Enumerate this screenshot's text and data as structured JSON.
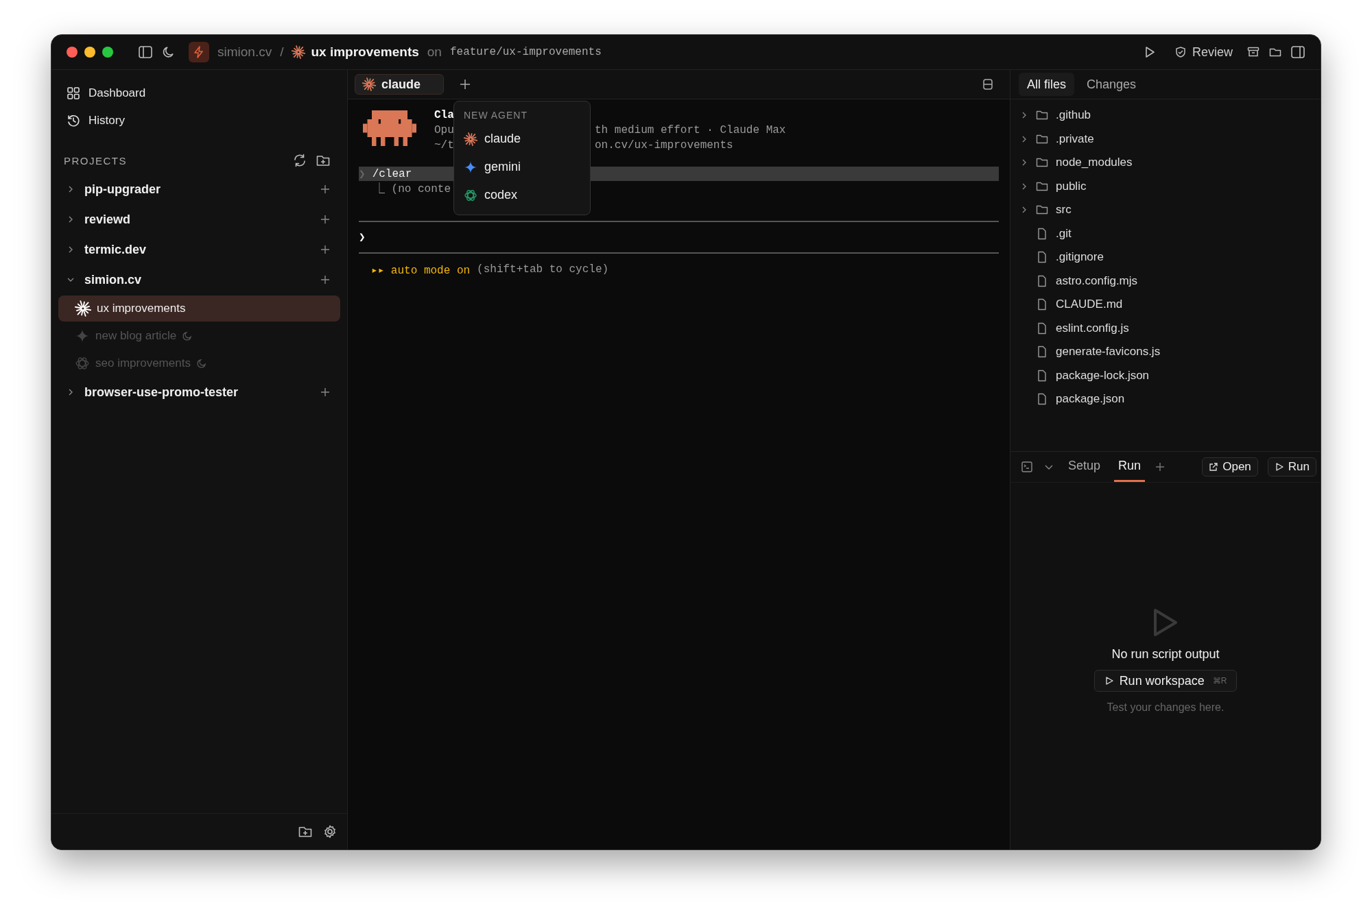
{
  "title_bar": {
    "project": "simion.cv",
    "separator": "/",
    "workspace": {
      "label": "ux improvements",
      "kind": "claude"
    },
    "on": "on",
    "branch": "feature/ux-improvements",
    "review": "Review"
  },
  "sidebar": {
    "nav": [
      {
        "label": "Dashboard",
        "kind": "dashboard"
      },
      {
        "label": "History",
        "kind": "history"
      }
    ],
    "projects_label": "PROJECTS",
    "projects": [
      {
        "name": "pip-upgrader",
        "expanded": false
      },
      {
        "name": "reviewd",
        "expanded": false
      },
      {
        "name": "termic.dev",
        "expanded": false
      },
      {
        "name": "simion.cv",
        "expanded": true,
        "children": [
          {
            "name": "ux improvements",
            "kind": "claude",
            "selected": true,
            "sleeping": false
          },
          {
            "name": "new blog article",
            "kind": "gemini",
            "selected": false,
            "sleeping": true
          },
          {
            "name": "seo improvements",
            "kind": "codex",
            "selected": false,
            "sleeping": true
          }
        ]
      },
      {
        "name": "browser-use-promo-tester",
        "expanded": false
      }
    ]
  },
  "terminal": {
    "tabs": [
      {
        "label": "claude",
        "kind": "claude",
        "selected": true
      }
    ],
    "header": {
      "title": "Cla",
      "line_2_left": "Opu",
      "line_2_right": "th medium effort · Claude Max",
      "line_3_left": "~/t",
      "line_3_right": "on.cv/ux-improvements"
    },
    "history": [
      {
        "marker": "❯",
        "command": "/clear",
        "branch": "⎿",
        "output": "(no conte"
      }
    ],
    "prompt": "❯",
    "mode": {
      "arrows": "▸▸",
      "label": "auto mode on",
      "hint": "(shift+tab to cycle)"
    }
  },
  "agent_menu": {
    "header": "NEW AGENT",
    "items": [
      {
        "label": "claude",
        "kind": "claude"
      },
      {
        "label": "gemini",
        "kind": "gemini"
      },
      {
        "label": "codex",
        "kind": "codex"
      }
    ]
  },
  "files": {
    "tabs": [
      {
        "label": "All files",
        "selected": true
      },
      {
        "label": "Changes",
        "selected": false
      }
    ],
    "items": [
      {
        "name": ".github",
        "kind": "folder"
      },
      {
        "name": ".private",
        "kind": "folder"
      },
      {
        "name": "node_modules",
        "kind": "folder"
      },
      {
        "name": "public",
        "kind": "folder"
      },
      {
        "name": "src",
        "kind": "folder"
      },
      {
        "name": ".git",
        "kind": "file"
      },
      {
        "name": ".gitignore",
        "kind": "file"
      },
      {
        "name": "astro.config.mjs",
        "kind": "file"
      },
      {
        "name": "CLAUDE.md",
        "kind": "file"
      },
      {
        "name": "eslint.config.js",
        "kind": "file"
      },
      {
        "name": "generate-favicons.js",
        "kind": "file"
      },
      {
        "name": "package-lock.json",
        "kind": "file"
      },
      {
        "name": "package.json",
        "kind": "file"
      }
    ]
  },
  "run_panel": {
    "tabs": [
      {
        "label": "Setup",
        "selected": false
      },
      {
        "label": "Run",
        "selected": true
      }
    ],
    "open": "Open",
    "run": "Run",
    "empty": {
      "title": "No run script output",
      "button": "Run workspace",
      "shortcut": "⌘R",
      "hint": "Test your changes here."
    }
  }
}
